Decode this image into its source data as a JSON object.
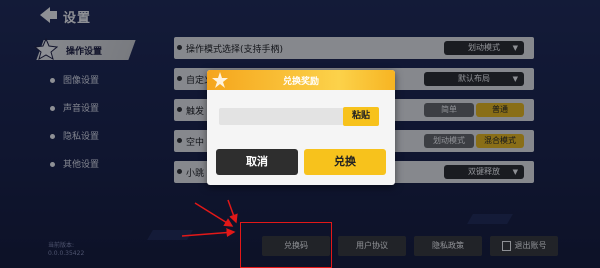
{
  "header": {
    "title": "设置",
    "back_icon": "back-arrow-icon"
  },
  "sidebar": {
    "items": [
      {
        "label": "操作设置",
        "active": true
      },
      {
        "label": "图像设置",
        "active": false
      },
      {
        "label": "声音设置",
        "active": false
      },
      {
        "label": "隐私设置",
        "active": false
      },
      {
        "label": "其他设置",
        "active": false
      }
    ]
  },
  "settings": {
    "rows": [
      {
        "label": "操作模式选择(支持手柄)",
        "options": [
          "划动模式"
        ]
      },
      {
        "label": "自定义",
        "options": [
          "默认布局"
        ]
      },
      {
        "label": "触发",
        "options": [
          "简单",
          "普通"
        ]
      },
      {
        "label": "空中",
        "options": [
          "划动模式",
          "混合模式"
        ]
      },
      {
        "label": "小跳",
        "options": [
          "双键释放"
        ]
      }
    ]
  },
  "modal": {
    "title": "兑换奖励",
    "input_value": "",
    "paste_label": "粘贴",
    "cancel_label": "取消",
    "confirm_label": "兑换"
  },
  "footer": {
    "version_label": "当前版本:",
    "version_value": "0.0.0.35422",
    "buttons": [
      "兑换码",
      "用户协议",
      "隐私政策",
      "退出账号"
    ]
  },
  "colors": {
    "accent": "#f7c21c",
    "background": "#1e2650",
    "annotation": "#e21818"
  }
}
